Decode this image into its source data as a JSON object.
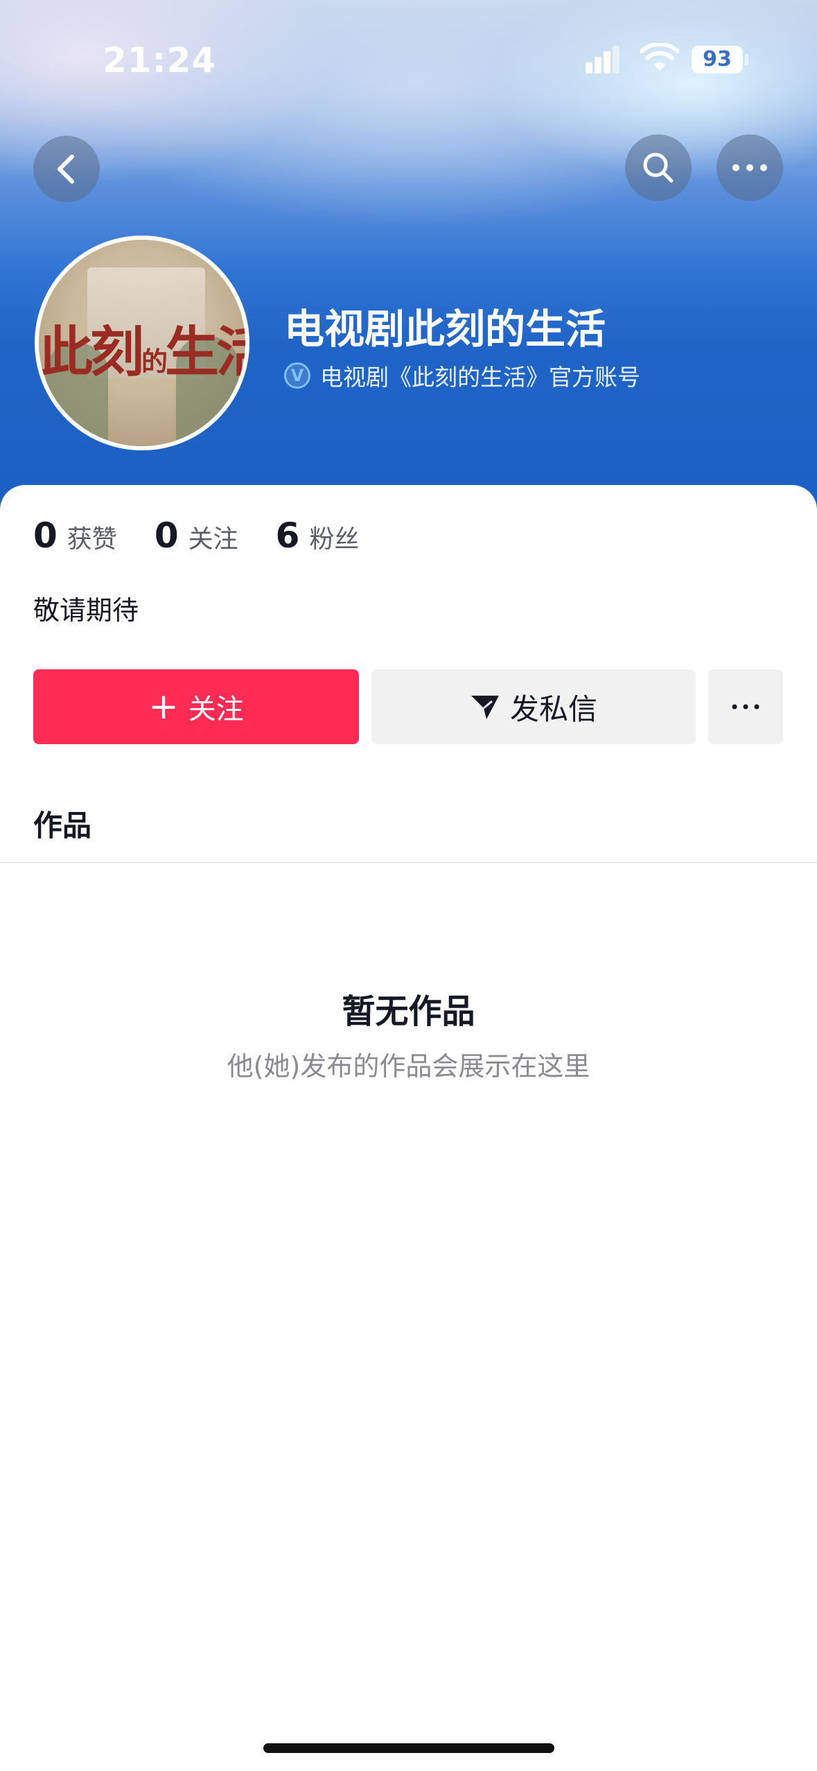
{
  "status_bar": {
    "time": "21:24",
    "battery": "93"
  },
  "header": {
    "back_icon": "chevron-left-icon",
    "search_icon": "search-icon",
    "more_icon": "more-horizontal-icon"
  },
  "profile": {
    "avatar_text_main": "此刻",
    "avatar_text_small": "的",
    "avatar_text_end": "生活",
    "name": "电视剧此刻的生活",
    "verify_badge": "V",
    "verify_text": "电视剧《此刻的生活》官方账号",
    "stats": [
      {
        "value": "0",
        "label": "获赞"
      },
      {
        "value": "0",
        "label": "关注"
      },
      {
        "value": "6",
        "label": "粉丝"
      }
    ],
    "bio": "敬请期待"
  },
  "actions": {
    "follow_plus": "+",
    "follow_label": "关注",
    "message_label": "发私信"
  },
  "works": {
    "tab_label": "作品",
    "empty_title": "暂无作品",
    "empty_subtitle": "他(她)发布的作品会展示在这里"
  },
  "colors": {
    "follow": "#fe2c55",
    "banner_blue": "#1f64c6",
    "verify": "#7cc4ff"
  }
}
